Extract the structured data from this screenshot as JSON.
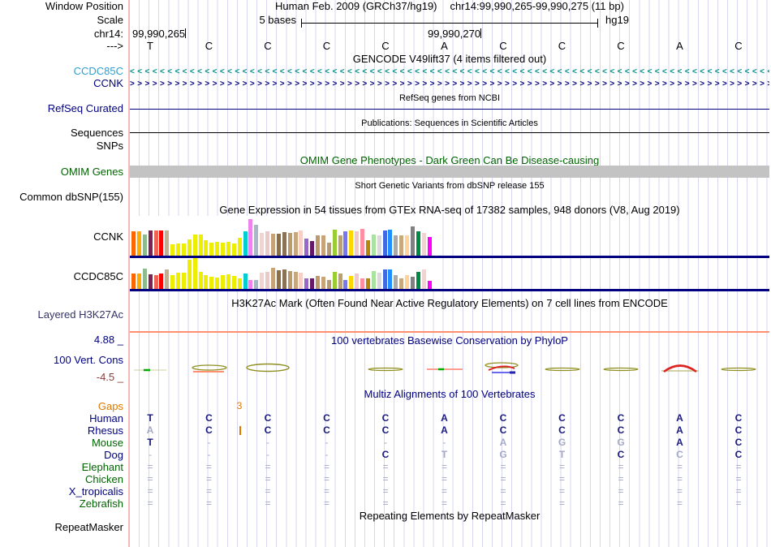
{
  "header": {
    "window_position_label": "Window Position",
    "assembly_title": "Human Feb. 2009 (GRCh37/hg19)",
    "position": "chr14:99,990,265-99,990,275 (11 bp)",
    "scale_label": "Scale",
    "scale_value": "5 bases",
    "scale_assembly": "hg19",
    "chrom_label": "chr14:",
    "coord_left": "99,990,265",
    "coord_right": "99,990,270",
    "strand_label": "--->",
    "bases": [
      "T",
      "C",
      "C",
      "C",
      "C",
      "A",
      "C",
      "C",
      "C",
      "A",
      "C"
    ]
  },
  "tracks": {
    "gencode": {
      "title": "GENCODE V49lift37 (4 items filtered out)",
      "genes": [
        {
          "name": "CCDC85C",
          "direction": "left",
          "label_color": "#2f9fd1",
          "arrow_color": "#008b8b"
        },
        {
          "name": "CCNK",
          "direction": "right",
          "label_color": "#000080",
          "arrow_color": "#000080"
        }
      ]
    },
    "refseq": {
      "title": "RefSeq genes from NCBI",
      "label": "RefSeq Curated"
    },
    "publications": {
      "title": "Publications: Sequences in Scientific Articles",
      "label_sequences": "Sequences",
      "label_snps": "SNPs"
    },
    "omim": {
      "title": "OMIM Gene Phenotypes - Dark Green Can Be Disease-causing",
      "label": "OMIM Genes"
    },
    "dbsnp": {
      "title": "Short Genetic Variants from dbSNP release 155",
      "label": "Common dbSNP(155)"
    },
    "gtex": {
      "title": "Gene Expression in 54 tissues from GTEx RNA-seq of 17382 samples, 948 donors (V8, Aug 2019)"
    },
    "h3k27ac": {
      "title": "H3K27Ac Mark (Often Found Near Active Regulatory Elements) on 7 cell lines from ENCODE",
      "label": "Layered H3K27Ac"
    },
    "phylop": {
      "title": "100 vertebrates Basewise Conservation by PhyloP",
      "label": "100 Vert. Cons",
      "max_label": "4.88 _",
      "min_label": "-4.5 _",
      "glyphs": [
        {
          "col": 1,
          "type": "dot-green"
        },
        {
          "col": 2,
          "type": "ellipse-salmon"
        },
        {
          "col": 3,
          "type": "ellipse"
        },
        {
          "col": 5,
          "type": "thin"
        },
        {
          "col": 6,
          "type": "salmon-green"
        },
        {
          "col": 7,
          "type": "multi"
        },
        {
          "col": 8,
          "type": "thin"
        },
        {
          "col": 9,
          "type": "thin"
        },
        {
          "col": 10,
          "type": "arc-red"
        },
        {
          "col": 11,
          "type": "thin"
        }
      ]
    },
    "multiz": {
      "title": "Multiz Alignments of 100 Vertebrates",
      "gaps_label": "Gaps",
      "gap_value": "3",
      "species": [
        {
          "name": "Human",
          "label_color": "#000080",
          "cells": [
            "T",
            "C",
            "C",
            "C",
            "C",
            "A",
            "C",
            "C",
            "C",
            "A",
            "C"
          ],
          "dim": [
            0,
            0,
            0,
            0,
            0,
            0,
            0,
            0,
            0,
            0,
            0
          ]
        },
        {
          "name": "Rhesus",
          "label_color": "#000080",
          "cells": [
            "A",
            "C",
            "C",
            "C",
            "C",
            "A",
            "C",
            "C",
            "C",
            "A",
            "C"
          ],
          "dim": [
            1,
            0,
            0,
            0,
            0,
            0,
            0,
            0,
            0,
            0,
            0
          ],
          "insertion_after_col": 2
        },
        {
          "name": "Mouse",
          "label_color": "#006400",
          "cells": [
            "T",
            "-",
            "-",
            "-",
            "-",
            "-",
            "A",
            "G",
            "G",
            "A",
            "C"
          ],
          "dim": [
            0,
            1,
            1,
            1,
            1,
            1,
            1,
            1,
            1,
            0,
            0
          ]
        },
        {
          "name": "Dog",
          "label_color": "#000080",
          "cells": [
            "-",
            "-",
            "-",
            "-",
            "C",
            "T",
            "G",
            "T",
            "C",
            "C",
            "C"
          ],
          "dim": [
            1,
            1,
            1,
            1,
            0,
            1,
            1,
            1,
            0,
            1,
            0
          ]
        },
        {
          "name": "Elephant",
          "label_color": "#006400",
          "cells": [
            "=",
            "=",
            "=",
            "=",
            "=",
            "=",
            "=",
            "=",
            "=",
            "=",
            "="
          ],
          "dim": [
            1,
            1,
            1,
            1,
            1,
            1,
            1,
            1,
            1,
            1,
            1
          ]
        },
        {
          "name": "Chicken",
          "label_color": "#006400",
          "cells": [
            "=",
            "=",
            "=",
            "=",
            "=",
            "=",
            "=",
            "=",
            "=",
            "=",
            "="
          ],
          "dim": [
            1,
            1,
            1,
            1,
            1,
            1,
            1,
            1,
            1,
            1,
            1
          ]
        },
        {
          "name": "X_tropicalis",
          "label_color": "#000080",
          "cells": [
            "=",
            "=",
            "=",
            "=",
            "=",
            "=",
            "=",
            "=",
            "=",
            "=",
            "="
          ],
          "dim": [
            1,
            1,
            1,
            1,
            1,
            1,
            1,
            1,
            1,
            1,
            1
          ]
        },
        {
          "name": "Zebrafish",
          "label_color": "#006400",
          "cells": [
            "=",
            "=",
            "=",
            "=",
            "=",
            "=",
            "=",
            "=",
            "=",
            "=",
            "="
          ],
          "dim": [
            1,
            1,
            1,
            1,
            1,
            1,
            1,
            1,
            1,
            1,
            1
          ]
        }
      ]
    },
    "repeatmasker": {
      "title": "Repeating Elements by RepeatMasker",
      "label": "RepeatMasker"
    }
  },
  "chart_data": {
    "type": "bar",
    "title": "Gene Expression in 54 tissues from GTEx RNA-seq of 17382 samples, 948 donors (V8, Aug 2019)",
    "categories_note": "54 GTEx tissues (unlabeled in image), GTEx tissue color palette",
    "tissue_colors": [
      "#ff6600",
      "#ffaa00",
      "#8fbc8f",
      "#7d2354",
      "#ee6352",
      "#ff0000",
      "#c3b091",
      "#eeee00",
      "#eeee00",
      "#eeee00",
      "#eeee00",
      "#eeee00",
      "#eeee00",
      "#eeee00",
      "#eeee00",
      "#eeee00",
      "#eeee00",
      "#eeee00",
      "#eeee00",
      "#eeee00",
      "#00ced1",
      "#ee82ee",
      "#a6b8c7",
      "#eed5d2",
      "#ecc9c9",
      "#c8a377",
      "#8b6f47",
      "#8b7355",
      "#bc9a6c",
      "#c9a77c",
      "#f7cfc7",
      "#9966cc",
      "#66186a",
      "#bc9a6c",
      "#c8a377",
      "#b89b74",
      "#9acd32",
      "#bca06e",
      "#7a77ee",
      "#ffd700",
      "#f4c8c8",
      "#ff8fa0",
      "#b8860b",
      "#a8e4a0",
      "#d9d9d9",
      "#4169e1",
      "#1e90ff",
      "#a9a9a9",
      "#c7a97c",
      "#ffd39b",
      "#808080",
      "#008b45",
      "#eed5d2",
      "#ff00ff"
    ],
    "series": [
      {
        "name": "CCNK",
        "values_pct": [
          62,
          62,
          54,
          64,
          64,
          64,
          64,
          28,
          31,
          31,
          40,
          54,
          54,
          38,
          33,
          34,
          33,
          34,
          30,
          44,
          62,
          92,
          78,
          58,
          62,
          55,
          55,
          60,
          58,
          60,
          64,
          42,
          36,
          52,
          50,
          33,
          66,
          52,
          62,
          64,
          62,
          68,
          38,
          54,
          50,
          64,
          66,
          52,
          50,
          52,
          74,
          62,
          58,
          46
        ]
      },
      {
        "name": "CCDC85C",
        "values_pct": [
          50,
          50,
          65,
          48,
          46,
          50,
          62,
          46,
          52,
          52,
          96,
          100,
          55,
          46,
          40,
          38,
          45,
          48,
          42,
          33,
          50,
          30,
          28,
          52,
          55,
          68,
          60,
          62,
          58,
          55,
          52,
          35,
          33,
          42,
          40,
          30,
          55,
          50,
          30,
          42,
          50,
          35,
          35,
          58,
          52,
          62,
          62,
          45,
          35,
          45,
          40,
          55,
          62,
          25
        ]
      }
    ]
  },
  "colors": {
    "navy": "#000080",
    "letter": "#1a1a80",
    "dim_letter": "#a4a9c8",
    "skyblue": "#2f9fd1",
    "teal": "#008b8b",
    "dark_green": "#006400",
    "orange": "#e07800",
    "maroon": "#8b3a3a",
    "grid": "#d6d6f0",
    "guide": "#f5b8b8",
    "gray_bar": "#c3c3c3",
    "h3k27ac_line": "#ff8f70"
  }
}
